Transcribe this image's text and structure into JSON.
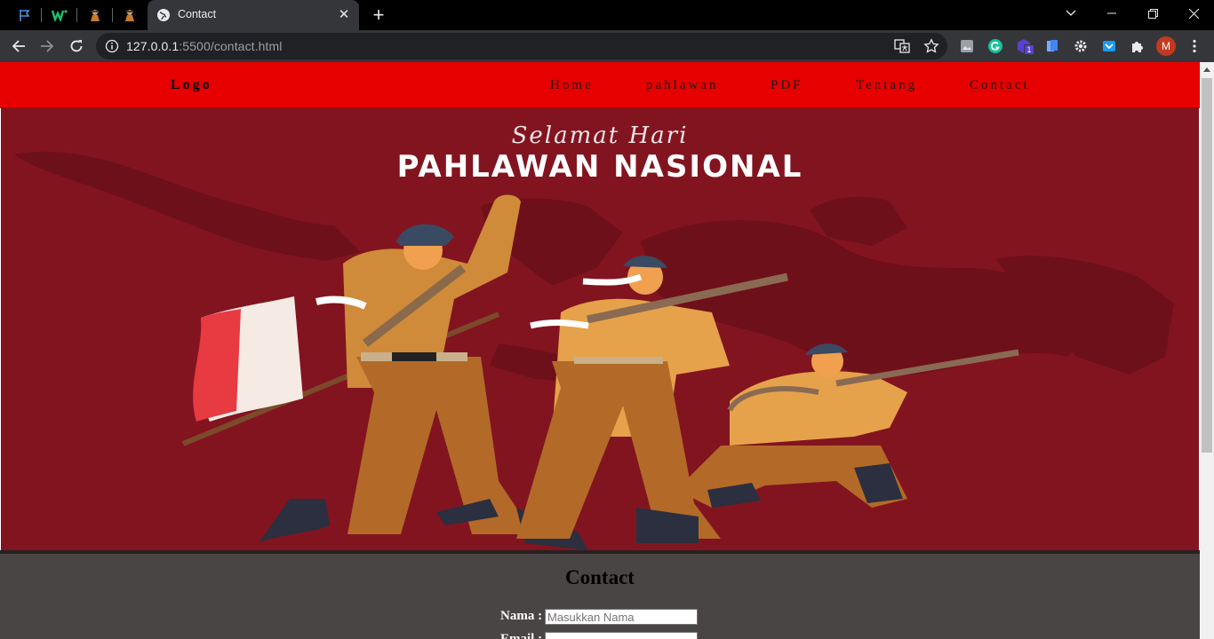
{
  "browser": {
    "active_tab_title": "Contact",
    "url_host": "127.0.0.1",
    "url_path": ":5500/contact.html",
    "profile_initial": "M",
    "extension_badge": "1"
  },
  "site": {
    "logo": "Logo",
    "nav": [
      "Home",
      "pahlawan",
      "PDF",
      "Tentang",
      "Contact"
    ]
  },
  "hero": {
    "script_text": "Selamat Hari",
    "title": "PAHLAWAN NASIONAL"
  },
  "contact": {
    "title": "Contact",
    "name_label": "Nama :",
    "name_placeholder": "Masukkan Nama",
    "email_label": "Email :"
  },
  "colors": {
    "nav_red": "#e60000",
    "hero_bg": "#821420",
    "contact_bg": "#4a4545"
  }
}
